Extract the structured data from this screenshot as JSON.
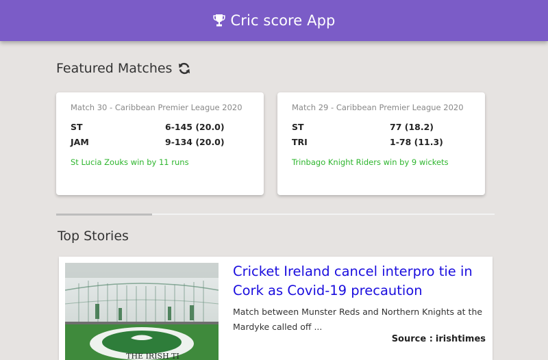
{
  "header": {
    "title": "Cric score App",
    "icon": "trophy-icon",
    "background": "#7b5cc7"
  },
  "featured": {
    "title": "Featured Matches",
    "refresh_icon": "refresh-icon",
    "matches": [
      {
        "name": "Match 30 - Caribbean Premier League 2020",
        "teams": [
          {
            "team": "ST",
            "score": "6-145 (20.0)"
          },
          {
            "team": "JAM",
            "score": "9-134 (20.0)"
          }
        ],
        "result": "St Lucia Zouks win by 11 runs"
      },
      {
        "name": "Match 29 - Caribbean Premier League 2020",
        "teams": [
          {
            "team": "ST",
            "score": "77 (18.2)"
          },
          {
            "team": "TRI",
            "score": "1-78 (11.3)"
          }
        ],
        "result": "Trinbago Knight Riders win by 9 wickets"
      }
    ],
    "result_color": "#2db52d"
  },
  "top_stories": {
    "title": "Top Stories",
    "stories": [
      {
        "headline": "Cricket Ireland cancel interpro tie in Cork as Covid-19 precaution",
        "description": "Match between Munster Reds and Northern Knights at the Mardyke called off ...",
        "source_label": "Source :",
        "source": "irishtimes",
        "image_caption": "THE IRISH TI"
      }
    ],
    "headline_color": "#1a0dde"
  }
}
